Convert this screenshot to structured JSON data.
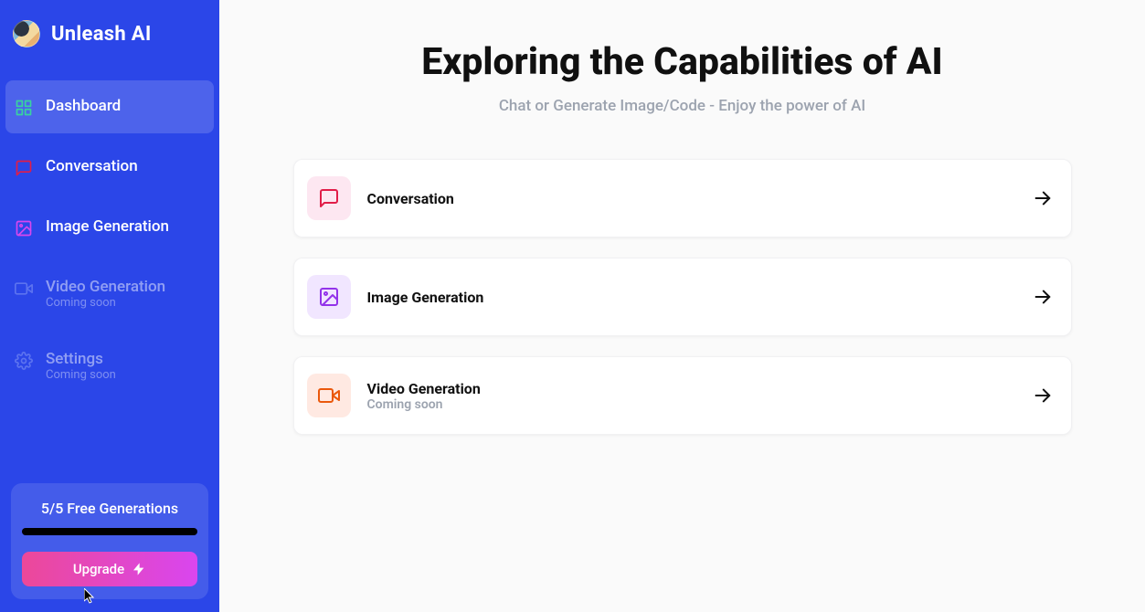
{
  "brand": {
    "title": "Unleash AI"
  },
  "sidebar": {
    "items": [
      {
        "label": "Dashboard"
      },
      {
        "label": "Conversation"
      },
      {
        "label": "Image Generation"
      },
      {
        "label": "Video Generation",
        "sub": "Coming soon"
      },
      {
        "label": "Settings",
        "sub": "Coming soon"
      }
    ]
  },
  "upgrade": {
    "count_text": "5/5 Free Generations",
    "button_label": "Upgrade"
  },
  "page": {
    "title": "Exploring the Capabilities of AI",
    "subtitle": "Chat or Generate Image/Code - Enjoy the power of AI"
  },
  "features": [
    {
      "title": "Conversation"
    },
    {
      "title": "Image Generation"
    },
    {
      "title": "Video Generation",
      "sub": "Coming soon"
    }
  ],
  "colors": {
    "sidebar_bg": "#2b46e8",
    "pink": "#e11d48",
    "purple": "#9333ea",
    "orange": "#ea580c",
    "upgrade_gradient_from": "#ec4899",
    "upgrade_gradient_to": "#d946ef"
  }
}
